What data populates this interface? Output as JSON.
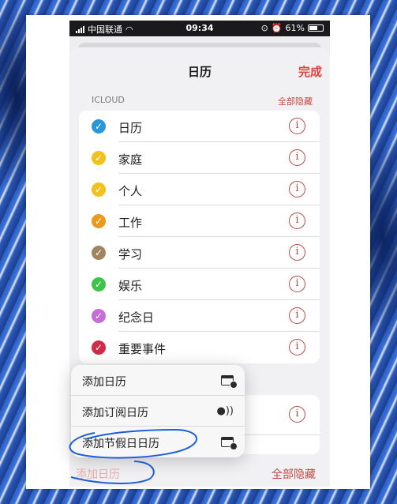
{
  "status_bar": {
    "carrier": "中国联通",
    "time": "09:34",
    "battery": "61%"
  },
  "nav": {
    "title": "日历",
    "done_label": "完成"
  },
  "icloud_section": {
    "header": "ICLOUD",
    "hide_all_label": "全部隐藏",
    "calendars": [
      {
        "label": "日历",
        "color": "#2a97d9",
        "checked": true
      },
      {
        "label": "家庭",
        "color": "#f2c21b",
        "checked": true
      },
      {
        "label": "个人",
        "color": "#f2c21b",
        "checked": true
      },
      {
        "label": "工作",
        "color": "#ec9a1f",
        "checked": true
      },
      {
        "label": "学习",
        "color": "#a08560",
        "checked": true
      },
      {
        "label": "娱乐",
        "color": "#3ec44a",
        "checked": true
      },
      {
        "label": "纪念日",
        "color": "#c46ddb",
        "checked": true
      },
      {
        "label": "重要事件",
        "color": "#cf2c48",
        "checked": true
      }
    ]
  },
  "popup_menu": {
    "items": [
      {
        "label": "添加日历",
        "icon": "calendar-add-icon"
      },
      {
        "label": "添加订阅日历",
        "icon": "broadcast-icon"
      },
      {
        "label": "添加节假日日历",
        "icon": "calendar-add-icon"
      }
    ]
  },
  "bottom_toolbar": {
    "add_calendar_label": "添加日历",
    "hide_all_label": "全部隐藏"
  },
  "colors": {
    "accent": "#d6453f",
    "annotation": "#1f5fd6"
  }
}
